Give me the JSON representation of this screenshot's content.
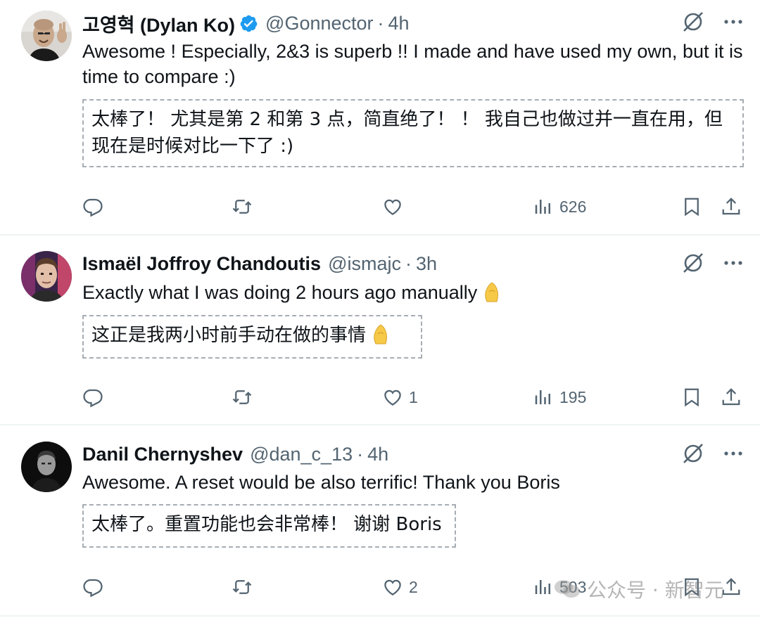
{
  "tweets": [
    {
      "name": "고영혁 (Dylan Ko)",
      "verified": true,
      "handle": "@Gonnector",
      "time": "4h",
      "text": "Awesome ! Especially, 2&3 is superb !! I made and have used my own, but it is time to compare :)",
      "translation": "太棒了！ 尤其是第 2 和第 3 点，简直绝了！ ！ 我自己也做过并一直在用，但现在是时候对比一下了 :)",
      "likes": "",
      "views": "626"
    },
    {
      "name": "Ismaël Joffroy Chandoutis",
      "verified": false,
      "handle": "@ismajc",
      "time": "3h",
      "text": "Exactly what I was doing 2 hours ago manually",
      "translation": "这正是我两小时前手动在做的事情",
      "likes": "1",
      "views": "195"
    },
    {
      "name": "Danil Chernyshev",
      "verified": false,
      "handle": "@dan_c_13",
      "time": "4h",
      "text": "Awesome. A reset would be also terrific! Thank you Boris",
      "translation": "太棒了。重置功能也会非常棒！ 谢谢 Boris",
      "likes": "2",
      "views": "503"
    }
  ],
  "icons": {
    "reply": "reply-icon",
    "retweet": "retweet-icon",
    "like": "heart-icon",
    "views": "views-icon",
    "bookmark": "bookmark-icon",
    "share": "share-icon",
    "grok": "grok-icon",
    "more": "more-icon"
  },
  "colors": {
    "text": "#0f1419",
    "muted": "#536471",
    "verified": "#1d9bf0",
    "divider": "#eff3f4"
  },
  "watermark": {
    "text": "公众号 · 新智元"
  }
}
